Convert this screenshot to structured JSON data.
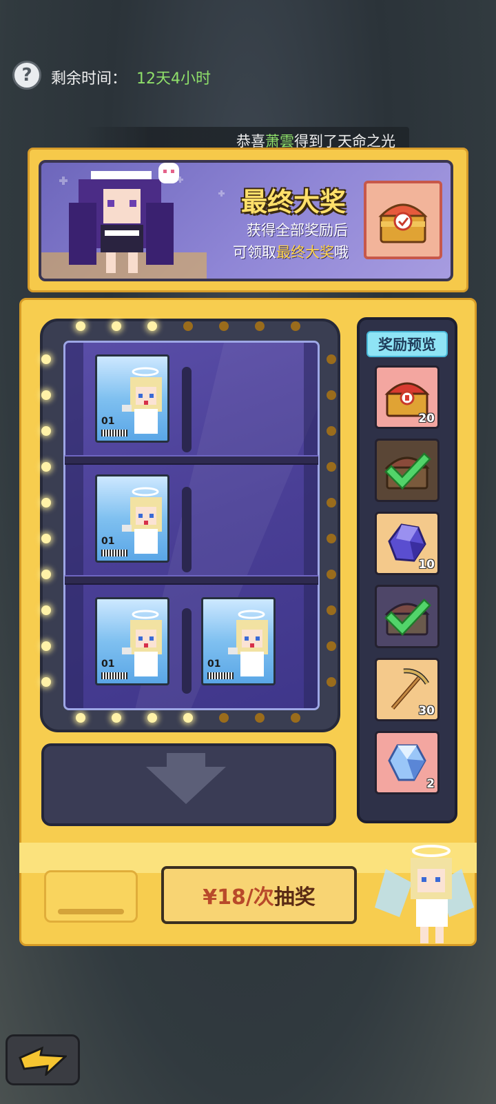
{
  "header": {
    "time_label": "剩余时间：",
    "time_value": "12天4小时"
  },
  "marquee": {
    "prefix": "恭喜",
    "player": "萧雲",
    "suffix": "得到了天命之光"
  },
  "banner": {
    "title": "最终大奖",
    "line1": "获得全部奖励后",
    "line2_prefix": "可领取",
    "line2_highlight": "最终大奖",
    "line2_suffix": "哦"
  },
  "blind_box_label": "01",
  "rewards": {
    "title": "奖励预览",
    "items": [
      {
        "name": "red-chest",
        "count": "20",
        "claimed": false
      },
      {
        "name": "chest-claimed",
        "count": "",
        "claimed": true
      },
      {
        "name": "purple-crystal",
        "count": "10",
        "claimed": false
      },
      {
        "name": "chest-claimed",
        "count": "",
        "claimed": true
      },
      {
        "name": "pickaxe",
        "count": "30",
        "claimed": false
      },
      {
        "name": "blue-gem",
        "count": "2",
        "claimed": false
      }
    ]
  },
  "draw_button": {
    "price": "¥18/次",
    "action": "抽奖"
  },
  "colors": {
    "machine_yellow": "#f7cd4f",
    "highlight_green": "#8fe06a",
    "draw_text": "#b84a2a"
  }
}
